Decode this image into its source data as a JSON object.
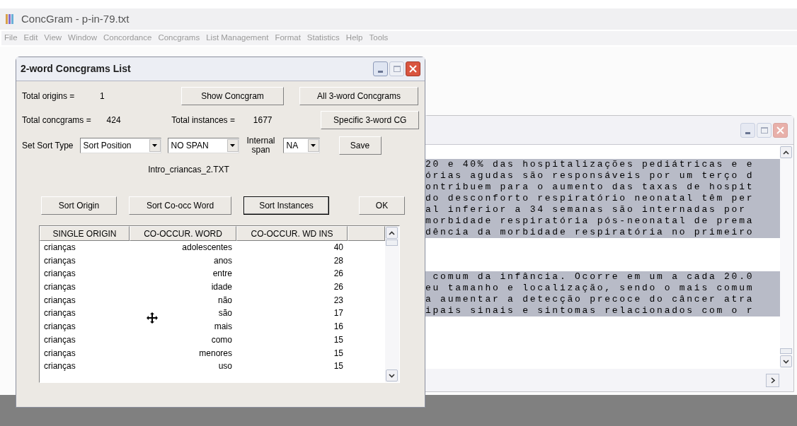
{
  "app": {
    "title": "ConcGram - p-in-79.txt",
    "menu": [
      "File",
      "Edit",
      "View",
      "Window",
      "Concordance",
      "Concgrams",
      "List Management",
      "Format",
      "Statistics",
      "Help",
      "Tools"
    ]
  },
  "dialog": {
    "title": "2-word Concgrams List",
    "origins_label": "Total origins =",
    "origins_value": "1",
    "concgrams_label": "Total concgrams =",
    "concgrams_value": "424",
    "instances_label": "Total instances =",
    "instances_value": "1677",
    "top_buttons": [
      "Show Concgram",
      "All 3-word Concgrams",
      "Specific 3-word CG"
    ],
    "sort_label": "Set Sort Type",
    "sort_select": "Sort Position",
    "span_select": "NO SPAN",
    "internal_label": "Internal span",
    "internal_select": "NA",
    "save_button": "Save",
    "file_name": "Intro_criancas_2.TXT",
    "sort_buttons": [
      {
        "label": "Sort Origin",
        "default": false
      },
      {
        "label": "Sort Co-occ Word",
        "default": false
      },
      {
        "label": "Sort Instances",
        "default": true
      },
      {
        "label": "OK",
        "default": false
      }
    ],
    "table": {
      "columns": [
        "SINGLE ORIGIN",
        "CO-OCCUR. WORD",
        "CO-OCCUR. WD INS"
      ],
      "rows": [
        [
          "crianças",
          "adolescentes",
          "40"
        ],
        [
          "crianças",
          "anos",
          "28"
        ],
        [
          "crianças",
          "entre",
          "26"
        ],
        [
          "crianças",
          "idade",
          "26"
        ],
        [
          "crianças",
          "não",
          "23"
        ],
        [
          "crianças",
          "são",
          "17"
        ],
        [
          "crianças",
          "mais",
          "16"
        ],
        [
          "crianças",
          "como",
          "15"
        ],
        [
          "crianças",
          "menores",
          "15"
        ],
        [
          "crianças",
          "uso",
          "15"
        ]
      ]
    }
  },
  "text_window": {
    "blocks": [
      {
        "highlighted": true,
        "lines": [
          "20 e 40% das hospitalizações pediátricas e e",
          "órias agudas são responsáveis por um terço d",
          "ontribuem para o aumento das taxas de hospit",
          "do desconforto respiratório neonatal têm per",
          "al inferior a 34 semanas são internadas por",
          "morbidade respiratória pós-neonatal de prema",
          "dência da morbidade respiratória no primeiro"
        ]
      },
      {
        "highlighted": true,
        "lines": [
          " comum da infância. Ocorre em um a cada 20.0",
          "eu tamanho e localização, sendo o mais comum",
          "a aumentar a detecção precoce do câncer atra",
          "ipais sinais e sintomas relacionados com o r"
        ]
      }
    ]
  }
}
